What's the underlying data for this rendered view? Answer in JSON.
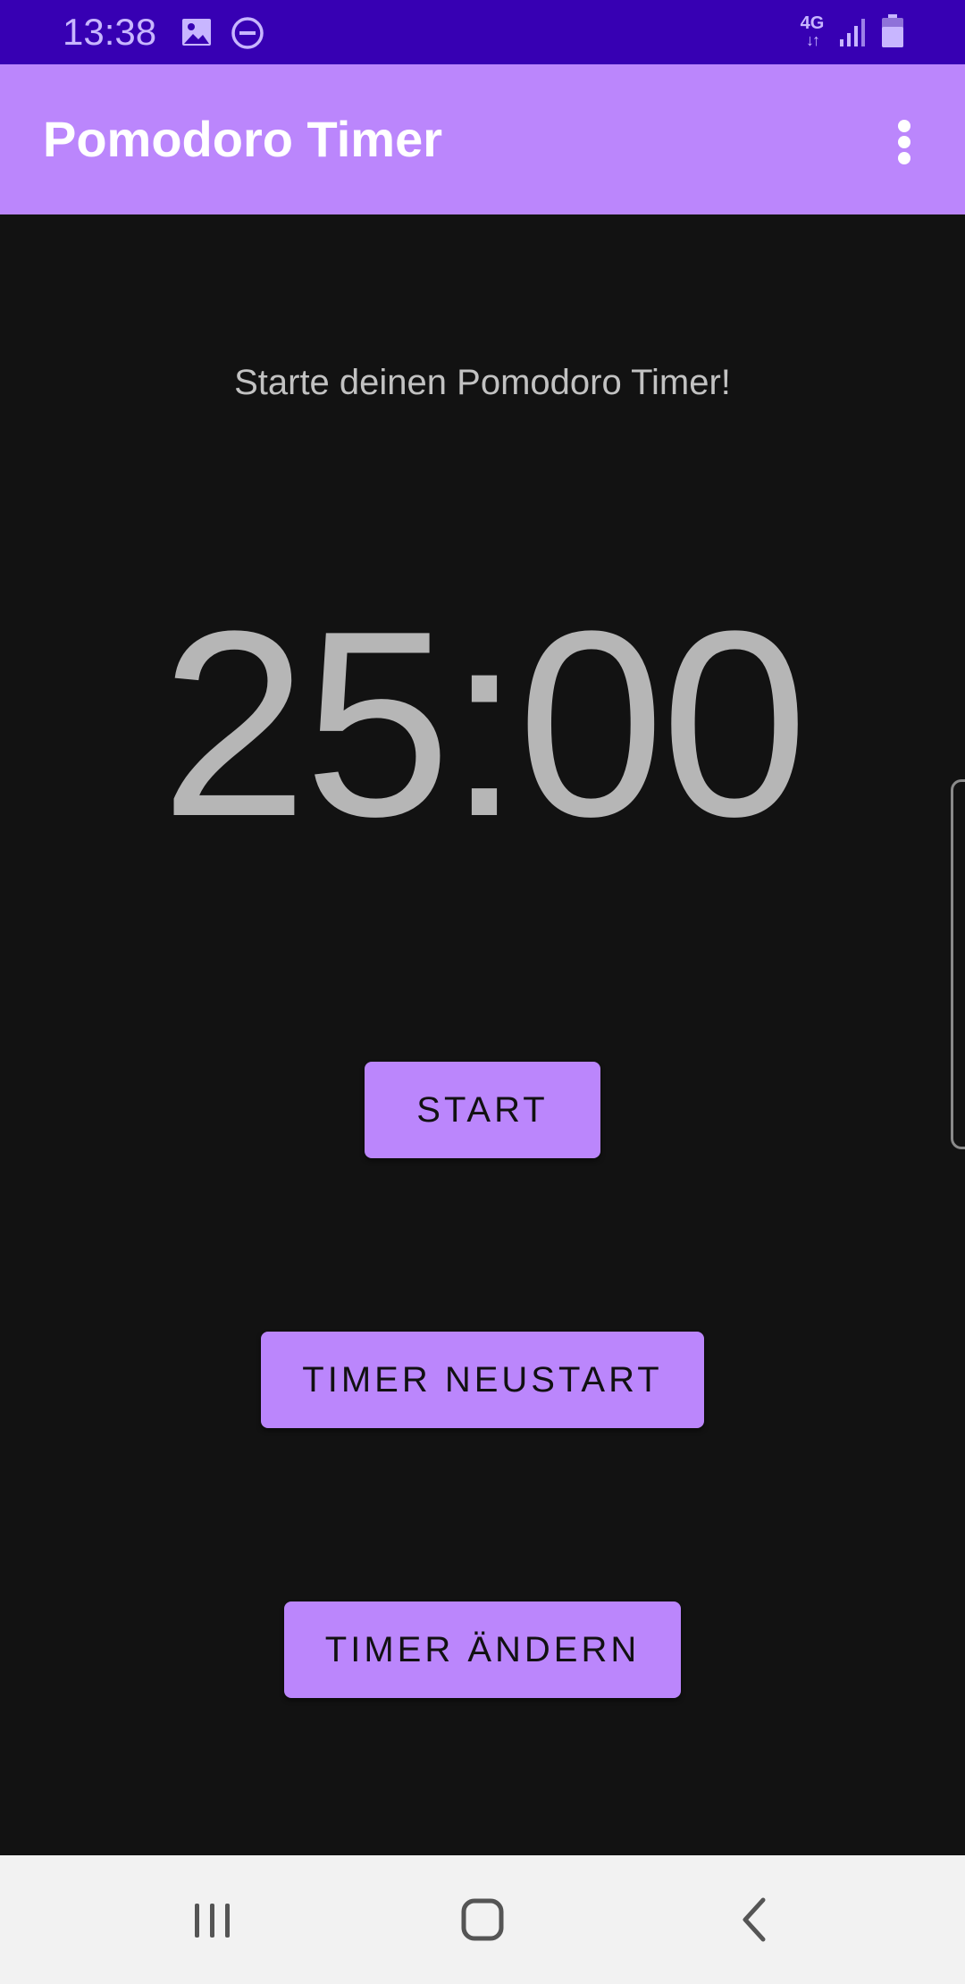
{
  "status_bar": {
    "time": "13:38",
    "network_label": "4G",
    "network_arrows": "↓↑",
    "icons": [
      "image-icon",
      "do-not-disturb-icon",
      "network-4g-icon",
      "signal-icon",
      "battery-icon"
    ],
    "background_color": "#3700b3"
  },
  "app_bar": {
    "title": "Pomodoro Timer",
    "menu_icon": "more-vert-icon",
    "background_color": "#bb86fc"
  },
  "main": {
    "subtitle": "Starte deinen Pomodoro Timer!",
    "timer": "25:00",
    "buttons": {
      "start": "START",
      "restart": "TIMER NEUSTART",
      "change": "TIMER ÄNDERN"
    },
    "background_color": "#121212",
    "accent_color": "#bb86fc"
  },
  "nav_bar": {
    "icons": [
      "recents-icon",
      "home-icon",
      "back-icon"
    ]
  }
}
